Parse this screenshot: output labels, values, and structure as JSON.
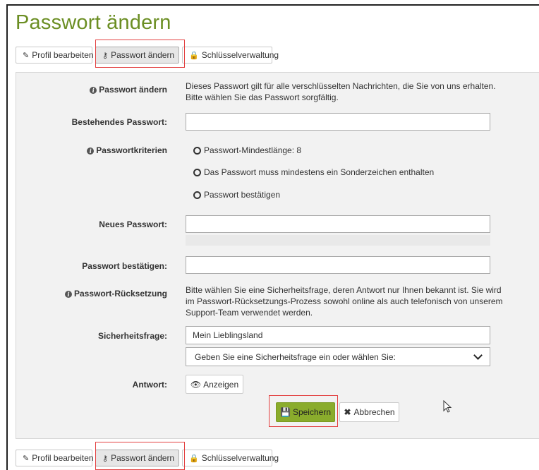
{
  "page_title": "Passwort ändern",
  "tabs": [
    {
      "label": "Profil bearbeiten",
      "icon": "pencil-icon"
    },
    {
      "label": "Passwort ändern",
      "icon": "key-icon"
    },
    {
      "label": "Schlüsselverwaltung",
      "icon": "lock-icon"
    }
  ],
  "form": {
    "intro_label": "Passwort ändern",
    "intro_text_1": "Dieses Passwort gilt für alle verschlüsselten Nachrichten, die Sie von uns erhalten.",
    "intro_text_2": "Bitte wählen Sie das Passwort sorgfältig.",
    "current_password_label": "Bestehendes Passwort:",
    "current_password_value": "",
    "criteria_label": "Passwortkriterien",
    "criteria": [
      "Passwort-Mindestlänge: 8",
      "Das Passwort muss mindestens ein Sonderzeichen enthalten",
      "Passwort bestätigen"
    ],
    "new_password_label": "Neues Passwort:",
    "new_password_value": "",
    "confirm_password_label": "Passwort bestätigen:",
    "confirm_password_value": "",
    "reset_label": "Passwort-Rücksetzung",
    "reset_text_1": "Bitte wählen Sie eine Sicherheitsfrage, deren Antwort nur Ihnen bekannt ist. Sie wird",
    "reset_text_2": "im Passwort-Rücksetzungs-Prozess sowohl online als auch telefonisch von unserem",
    "reset_text_3": "Support-Team verwendet werden.",
    "security_question_label": "Sicherheitsfrage:",
    "security_question_value": "Mein Lieblingsland",
    "security_question_select": "Geben Sie eine Sicherheitsfrage ein oder wählen Sie:",
    "answer_label": "Antwort:",
    "show_button": "Anzeigen",
    "save_button": "Speichern",
    "cancel_button": "Abbrechen"
  },
  "colors": {
    "title": "#6b8e23",
    "save_button": "#8aac2c",
    "highlight": "#e34040",
    "panel": "#f2f2f2"
  }
}
